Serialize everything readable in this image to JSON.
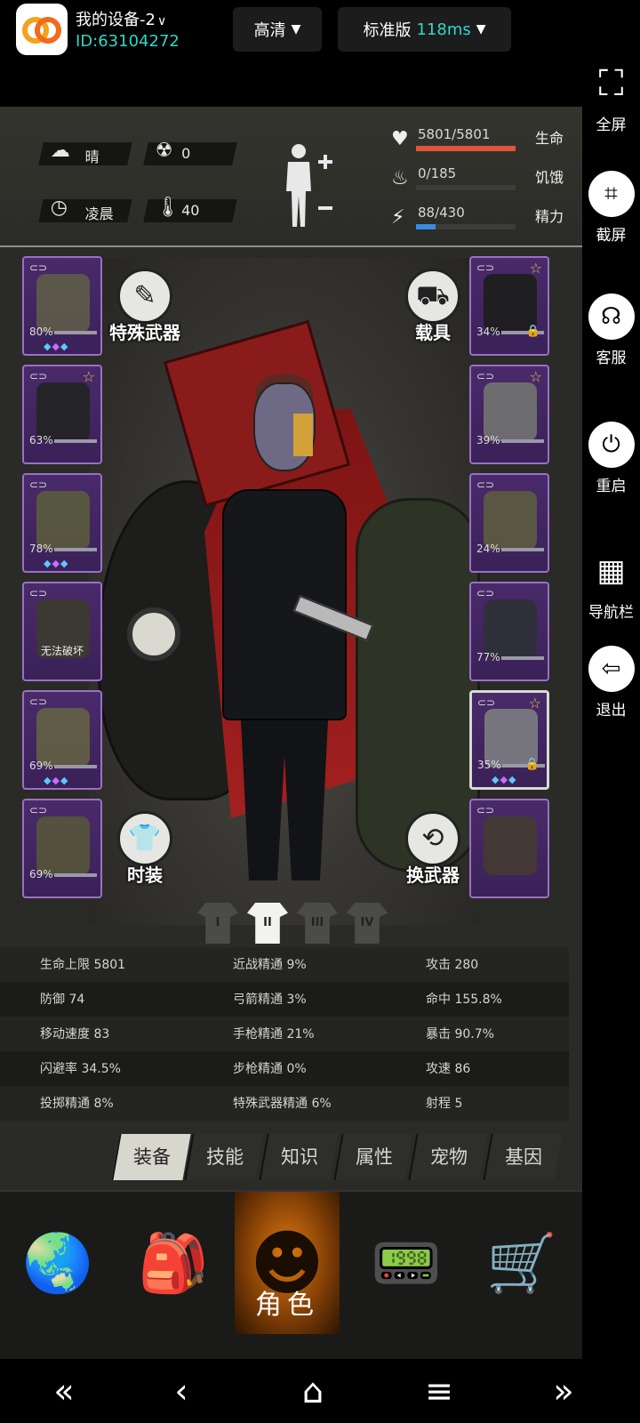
{
  "topbar": {
    "device_name": "我的设备-2",
    "device_chevron": "∨",
    "device_id": "ID:63104272",
    "quality_label": "高清",
    "mode_label": "标准版",
    "ping": "118ms",
    "dropdown_glyph": "▼"
  },
  "side_panel": [
    {
      "icon": "fullscreen-icon",
      "glyph": "⛶",
      "label": "全屏"
    },
    {
      "icon": "crop-icon",
      "glyph": "⌗",
      "label": "截屏"
    },
    {
      "icon": "headset-icon",
      "glyph": "☊",
      "label": "客服"
    },
    {
      "icon": "power-icon",
      "glyph": "⏻",
      "label": "重启"
    },
    {
      "icon": "grid-icon",
      "glyph": "▦",
      "label": "导航栏"
    },
    {
      "icon": "exit-icon",
      "glyph": "⇦",
      "label": "退出"
    }
  ],
  "hud": {
    "weather": {
      "icon": "cloud-sun-icon",
      "glyph": "☁",
      "value": "晴"
    },
    "radiation": {
      "icon": "radiation-icon",
      "glyph": "☢",
      "value": "0"
    },
    "time": {
      "icon": "clock-icon",
      "glyph": "◷",
      "value": "凌晨"
    },
    "temperature": {
      "icon": "thermometer-icon",
      "glyph": "🌡",
      "value": "40"
    },
    "vitals": [
      {
        "name": "生命",
        "value": "5801/5801",
        "icon": "heart-icon",
        "glyph": "♥",
        "fraction": 1.0,
        "color": "#e0553a"
      },
      {
        "name": "饥饿",
        "value": "0/185",
        "icon": "hunger-icon",
        "glyph": "♨",
        "fraction": 0.0,
        "color": "#c9a23a"
      },
      {
        "name": "精力",
        "value": "88/430",
        "icon": "energy-icon",
        "glyph": "⚡",
        "fraction": 0.2,
        "color": "#3a8ae0"
      }
    ]
  },
  "equipment": {
    "left": [
      {
        "name": "helmet",
        "durability": "80%",
        "gems": true,
        "star": false,
        "art_color": "#5d5a4a"
      },
      {
        "name": "jacket",
        "durability": "63%",
        "gems": false,
        "star": true,
        "art_color": "#242426"
      },
      {
        "name": "camo-jacket",
        "durability": "78%",
        "gems": true,
        "star": false,
        "art_color": "#59583e"
      },
      {
        "name": "backpack",
        "durability": "",
        "note": "无法破坏",
        "gems": false,
        "star": false,
        "art_color": "#3c3a30"
      },
      {
        "name": "camo-pants",
        "durability": "69%",
        "gems": true,
        "star": false,
        "art_color": "#615e44"
      },
      {
        "name": "boots",
        "durability": "69%",
        "gems": false,
        "star": false,
        "art_color": "#55533c"
      }
    ],
    "right": [
      {
        "name": "goggles",
        "durability": "34%",
        "gems": false,
        "star": true,
        "lock": true,
        "art_color": "#1e1e1e"
      },
      {
        "name": "gas-mask",
        "durability": "39%",
        "gems": false,
        "star": true,
        "lock": false,
        "art_color": "#707070"
      },
      {
        "name": "vest",
        "durability": "24%",
        "gems": false,
        "star": false,
        "lock": false,
        "art_color": "#5b5a42"
      },
      {
        "name": "shield",
        "durability": "77%",
        "gems": false,
        "star": false,
        "lock": false,
        "art_color": "#2e3038"
      },
      {
        "name": "revolver",
        "durability": "35%",
        "gems": true,
        "star": true,
        "lock": true,
        "art_color": "#7a7a80"
      },
      {
        "name": "grenade",
        "durability": "",
        "gems": false,
        "star": false,
        "lock": false,
        "art_color": "#433a33"
      }
    ],
    "link_glyph": "⊂⊃",
    "star_glyph": "☆",
    "lock_glyph": "🔒",
    "gem_glyph": "◆"
  },
  "actions": {
    "special_weapon": {
      "label": "特殊武器",
      "glyph": "✎"
    },
    "vehicle": {
      "label": "载具",
      "glyph": "⛟"
    },
    "fashion": {
      "label": "时装",
      "glyph": "👕"
    },
    "swap_weapon": {
      "label": "换武器",
      "glyph": "⟲"
    }
  },
  "outfits": [
    {
      "label": "I",
      "active": false
    },
    {
      "label": "II",
      "active": true
    },
    {
      "label": "III",
      "active": false
    },
    {
      "label": "IV",
      "active": false
    }
  ],
  "stats": [
    [
      "生命上限 5801",
      "近战精通 9%",
      "攻击 280"
    ],
    [
      "防御 74",
      "弓箭精通 3%",
      "命中 155.8%"
    ],
    [
      "移动速度 83",
      "手枪精通 21%",
      "暴击 90.7%"
    ],
    [
      "闪避率 34.5%",
      "步枪精通 0%",
      "攻速 86"
    ],
    [
      "投掷精通 8%",
      "特殊武器精通 6%",
      "射程 5"
    ]
  ],
  "tabs": [
    "装备",
    "技能",
    "知识",
    "属性",
    "宠物",
    "基因"
  ],
  "active_tab": 0,
  "bottom_nav": [
    {
      "icon": "globe-icon",
      "glyph": "🌏",
      "label": ""
    },
    {
      "icon": "backpack-icon",
      "glyph": "🎒",
      "label": ""
    },
    {
      "icon": "character-icon",
      "glyph": "☻",
      "label": "角色",
      "active": true
    },
    {
      "icon": "walkie-talkie-icon",
      "glyph": "📟",
      "label": ""
    },
    {
      "icon": "cart-icon",
      "glyph": "🛒",
      "label": ""
    }
  ],
  "system_nav": {
    "back_double": "«",
    "back": "‹",
    "home": "⌂",
    "menu": "≡",
    "forward_double": "»"
  }
}
